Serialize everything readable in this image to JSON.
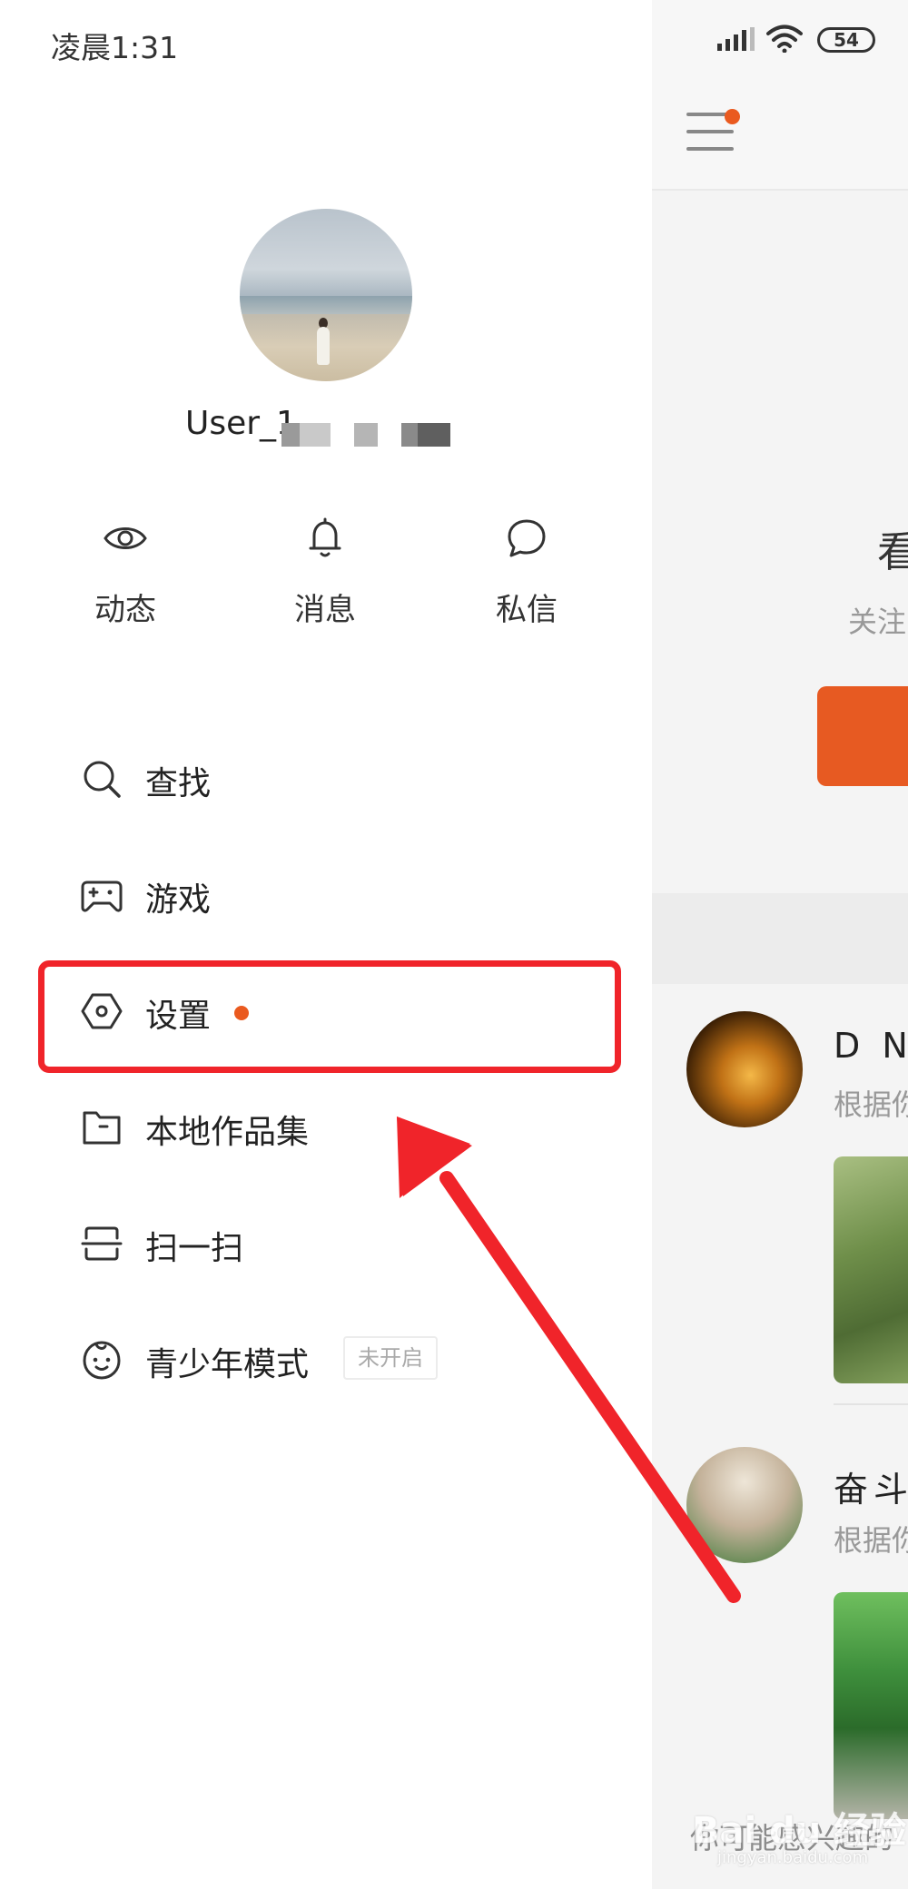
{
  "status_bar": {
    "time": "凌晨1:31",
    "battery": "54"
  },
  "profile": {
    "username": "User_1"
  },
  "quick_actions": [
    {
      "label": "动态",
      "icon": "eye-icon"
    },
    {
      "label": "消息",
      "icon": "bell-icon"
    },
    {
      "label": "私信",
      "icon": "chat-bubble-icon"
    }
  ],
  "menu": [
    {
      "label": "查找",
      "icon": "search-icon"
    },
    {
      "label": "游戏",
      "icon": "gamepad-icon"
    },
    {
      "label": "设置",
      "icon": "hexagon-settings-icon",
      "has_dot": true
    },
    {
      "label": "本地作品集",
      "icon": "folder-icon"
    },
    {
      "label": "扫一扫",
      "icon": "scan-icon"
    },
    {
      "label": "青少年模式",
      "icon": "child-face-icon",
      "badge": "未开启"
    }
  ],
  "background_page": {
    "heading_fragment": "看",
    "subtext_fragment": "关注",
    "interest_header": "你可能感兴趣的",
    "accounts": [
      {
        "name_fragment": "D N I",
        "reason_fragment": "根据你"
      },
      {
        "name_fragment": "奋斗",
        "reason_fragment": "根据你"
      }
    ]
  },
  "watermark": {
    "main": "Bai du 经验",
    "sub": "jingyan.baidu.com"
  },
  "colors": {
    "accent": "#ea5a1f",
    "highlight": "#f0242a",
    "drawer_bg": "#ffffff",
    "dimmed_bg": "#f4f4f4"
  }
}
